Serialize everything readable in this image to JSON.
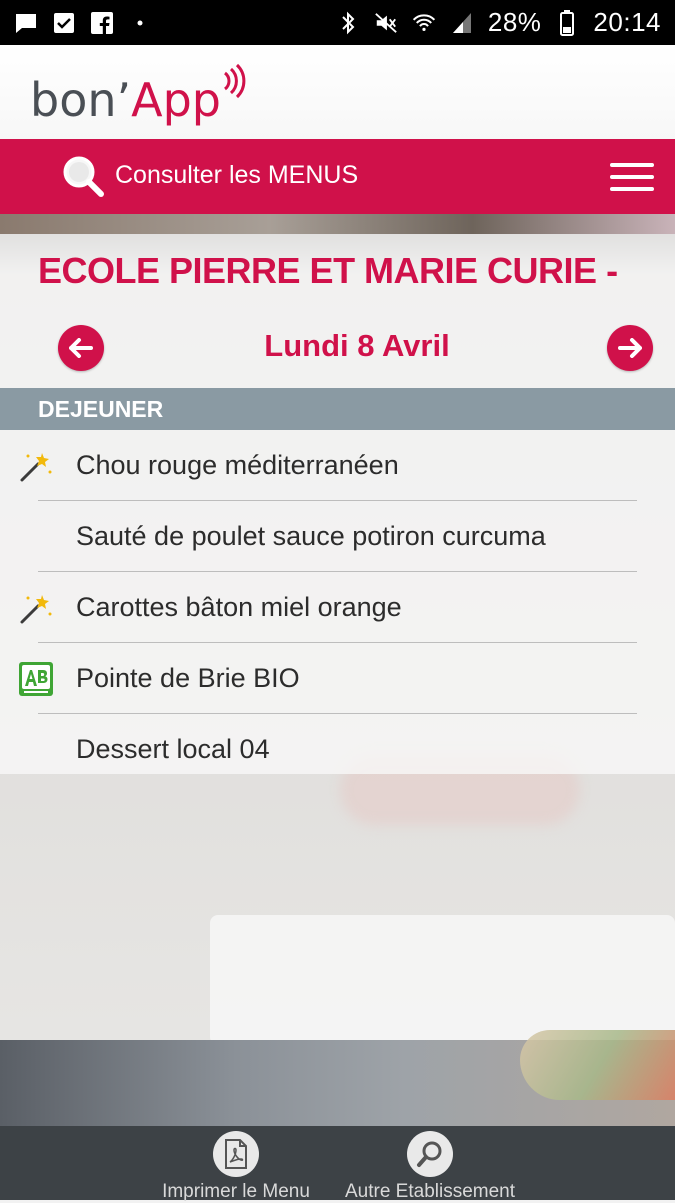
{
  "status_bar": {
    "battery": "28%",
    "time": "20:14",
    "left_icons": [
      "message-icon",
      "checkbox-icon",
      "facebook-icon",
      "dot-icon"
    ],
    "right_icons": [
      "bluetooth-icon",
      "mute-icon",
      "wifi-icon",
      "signal-icon",
      "battery-icon"
    ]
  },
  "header": {
    "logo_part1": "bon’",
    "logo_part2": "App"
  },
  "navbar": {
    "search_label": "Consulter les MENUS"
  },
  "menu": {
    "school_name": "ECOLE PIERRE ET MARIE CURIE -",
    "date": "Lundi 8 Avril",
    "meal": "DEJEUNER",
    "dishes": [
      {
        "label": "Chou rouge méditerranéen",
        "icon": "magic-wand-icon"
      },
      {
        "label": "Sauté de poulet sauce potiron curcuma",
        "icon": ""
      },
      {
        "label": "Carottes bâton miel orange",
        "icon": "magic-wand-icon"
      },
      {
        "label": "Pointe de Brie BIO",
        "icon": "organic-ab-icon"
      },
      {
        "label": "Dessert local 04",
        "icon": ""
      }
    ]
  },
  "bottom_bar": {
    "print_label": "Imprimer le Menu",
    "other_label": "Autre Etablissement"
  },
  "colors": {
    "brand": "#d0114a",
    "meal_header": "#8a9aa3",
    "bottom_bar": "#3d4246"
  }
}
